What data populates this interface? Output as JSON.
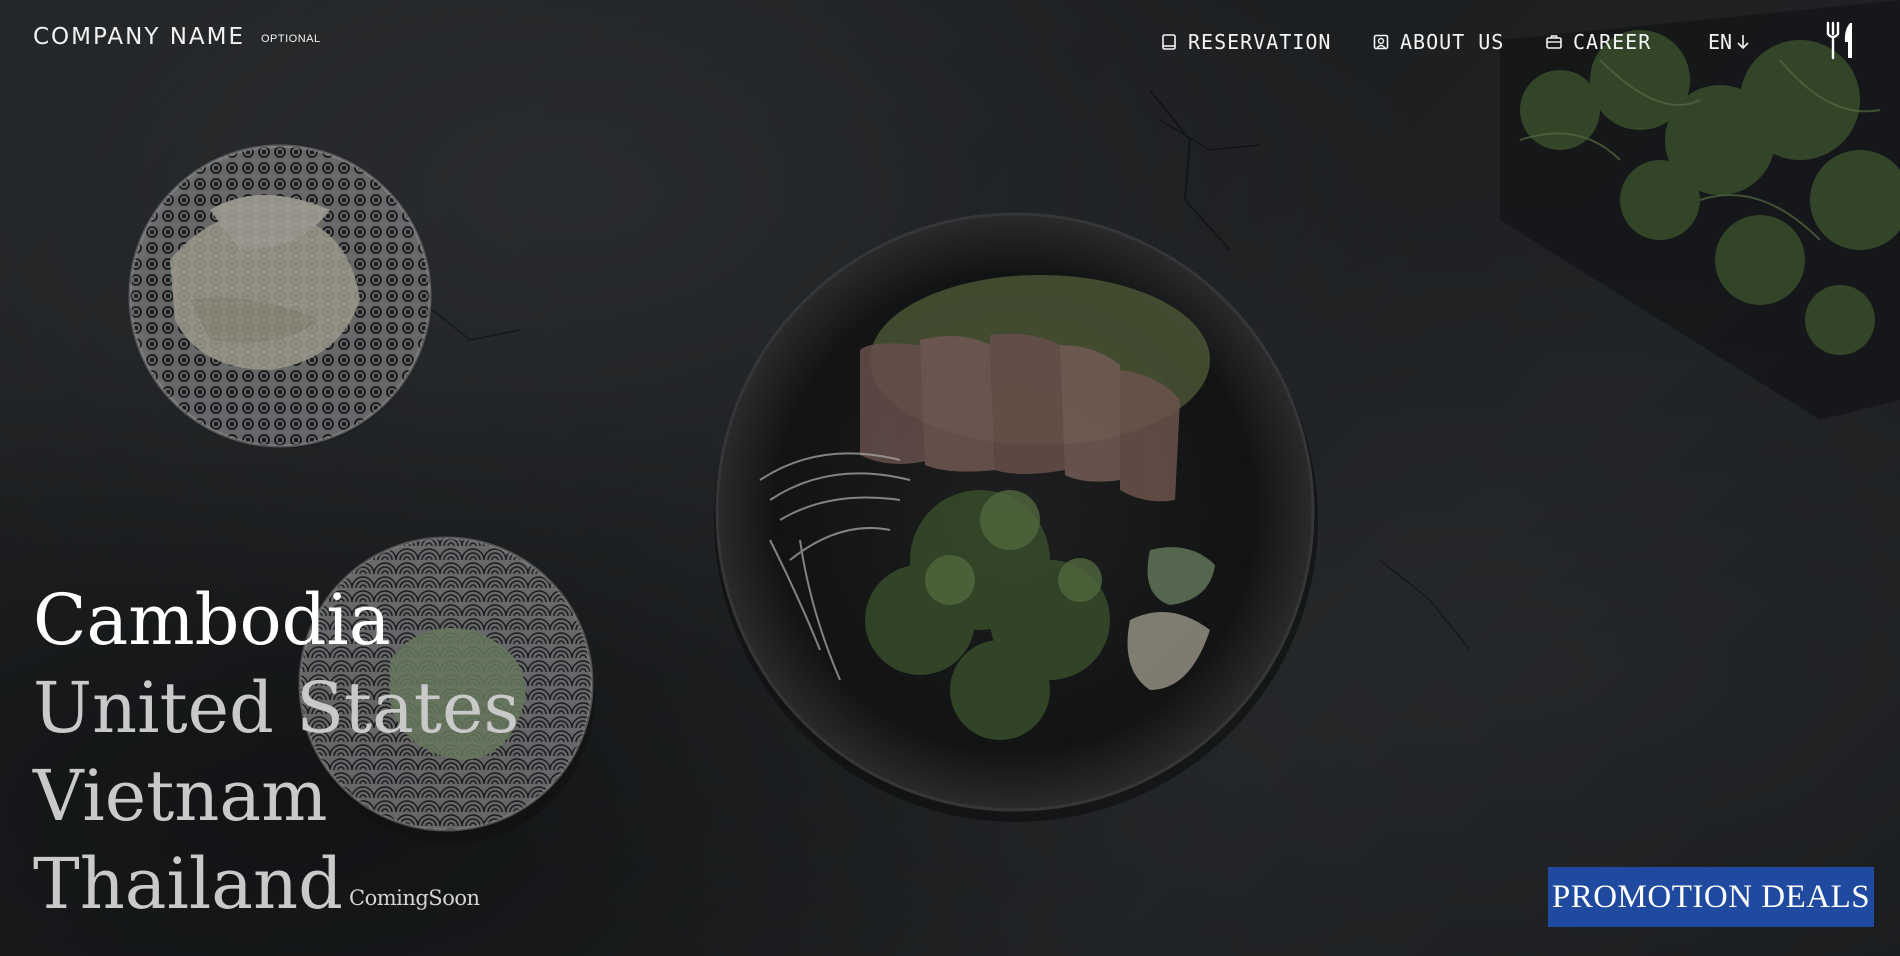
{
  "header": {
    "brand": "COMPANY NAME",
    "brand_tag": "OPTIONAL",
    "nav": {
      "reservation": "RESERVATION",
      "about": "ABOUT US",
      "career": "CAREER"
    },
    "language": "EN"
  },
  "hero": {
    "countries": [
      "Cambodia",
      "United States",
      "Vietnam",
      "Thailand"
    ],
    "active_country": "Cambodia",
    "coming_soon": "ComingSoon"
  },
  "promo_button": "PROMOTION DEALS",
  "colors": {
    "background": "#26292c",
    "promo": "#1f4aa0",
    "text": "#ffffff"
  },
  "icons": [
    "book-icon",
    "user-badge-icon",
    "briefcase-icon",
    "arrow-down-icon",
    "fork-knife-icon"
  ]
}
